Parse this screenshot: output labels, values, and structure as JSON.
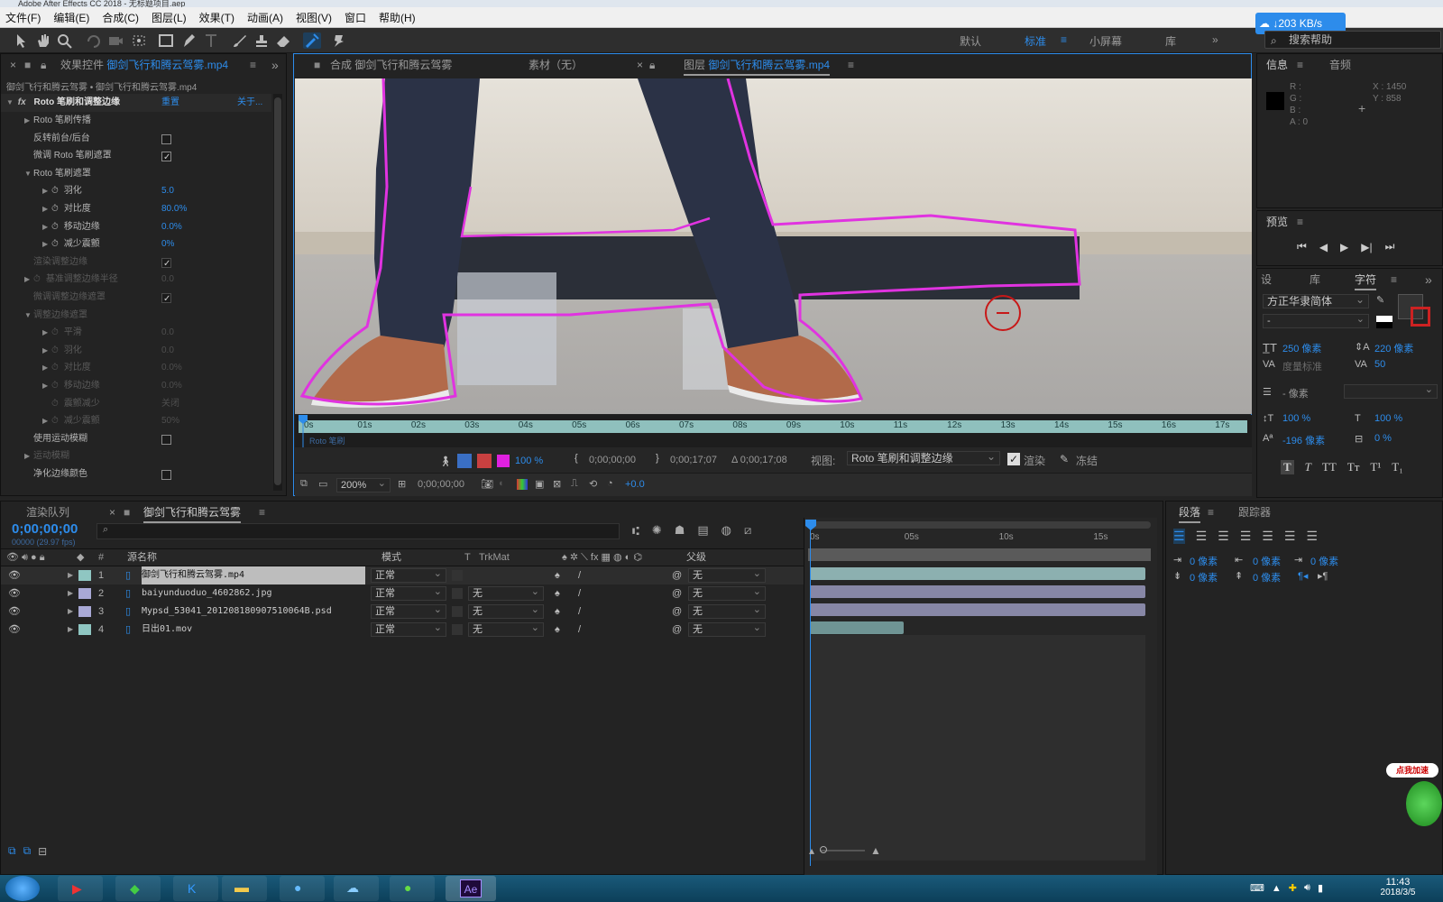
{
  "titlebar": {
    "text": "Adobe After Effects CC 2018 - 无标题项目.aep"
  },
  "menu": [
    "文件(F)",
    "编辑(E)",
    "合成(C)",
    "图层(L)",
    "效果(T)",
    "动画(A)",
    "视图(V)",
    "窗口",
    "帮助(H)"
  ],
  "workspaces": {
    "items": [
      "默认",
      "标准",
      "小屏幕",
      "库"
    ],
    "active": "标准"
  },
  "net_speed": "203 KB/s",
  "search_help": "搜索帮助",
  "effects_panel": {
    "tab_prefix": "效果控件",
    "tab_layer": "御剑飞行和腾云驾雾.mp4",
    "breadcrumb": "御剑飞行和腾云驾雾 • 御剑飞行和腾云驾雾.mp4",
    "effect_name": "Roto 笔刷和调整边缘",
    "reset": "重置",
    "about": "关于...",
    "rows": [
      {
        "label": "Roto 笔刷传播",
        "indent": 1,
        "tri": true
      },
      {
        "label": "反转前台/后台",
        "indent": 1,
        "check": "off"
      },
      {
        "label": "微调 Roto 笔刷遮罩",
        "indent": 1,
        "check": "on"
      },
      {
        "label": "Roto 笔刷遮罩",
        "indent": 1,
        "open": true
      },
      {
        "label": "羽化",
        "indent": 2,
        "tri": true,
        "stop": true,
        "value": "5.0"
      },
      {
        "label": "对比度",
        "indent": 2,
        "tri": true,
        "stop": true,
        "value": "80.0%"
      },
      {
        "label": "移动边缘",
        "indent": 2,
        "tri": true,
        "stop": true,
        "value": "0.0%"
      },
      {
        "label": "减少震颤",
        "indent": 2,
        "tri": true,
        "stop": true,
        "value": "0%"
      },
      {
        "label": "渲染调整边缘",
        "indent": 1,
        "check": "on",
        "dim": true
      },
      {
        "label": "基准调整边缘半径",
        "indent": 1,
        "tri": true,
        "stop": true,
        "value": "0.0",
        "dim": true
      },
      {
        "label": "微调调整边缘遮罩",
        "indent": 1,
        "check": "on",
        "dim": true
      },
      {
        "label": "调整边缘遮罩",
        "indent": 1,
        "open": true,
        "dim": true
      },
      {
        "label": "平滑",
        "indent": 2,
        "tri": true,
        "stop": true,
        "value": "0.0",
        "dim": true
      },
      {
        "label": "羽化",
        "indent": 2,
        "tri": true,
        "stop": true,
        "value": "0.0",
        "dim": true
      },
      {
        "label": "对比度",
        "indent": 2,
        "tri": true,
        "stop": true,
        "value": "0.0%",
        "dim": true
      },
      {
        "label": "移动边缘",
        "indent": 2,
        "tri": true,
        "stop": true,
        "value": "0.0%",
        "dim": true
      },
      {
        "label": "震颤减少",
        "indent": 2,
        "stop": true,
        "value": "关闭",
        "dim": true
      },
      {
        "label": "减少震颤",
        "indent": 2,
        "tri": true,
        "stop": true,
        "value": "50%",
        "dim": true
      },
      {
        "label": "使用运动模糊",
        "indent": 1,
        "check": "off"
      },
      {
        "label": "运动模糊",
        "indent": 1,
        "tri": true,
        "dim": true
      },
      {
        "label": "净化边缘颜色",
        "indent": 1,
        "check": "off"
      }
    ]
  },
  "viewer": {
    "tab_comp": "合成 御剑飞行和腾云驾雾",
    "tab_footage": "素材（无）",
    "tab_layer_prefix": "图层",
    "tab_layer_name": "御剑飞行和腾云驾雾.mp4",
    "ruler_labels": [
      "0s",
      "01s",
      "02s",
      "03s",
      "04s",
      "05s",
      "06s",
      "07s",
      "08s",
      "09s",
      "10s",
      "11s",
      "12s",
      "13s",
      "14s",
      "15s",
      "16s",
      "17s"
    ],
    "ruler_sub": "Roto 笔刷",
    "brush_pct": "100 %",
    "time_in": "0;00;00;00",
    "time_out": "0;00;17;07",
    "duration": "Δ 0;00;17;08",
    "view_label": "视图:",
    "view_value": "Roto 笔刷和调整边缘",
    "render_label": "渲染",
    "freeze_label": "冻结",
    "zoom": "200%",
    "current_time": "0;00;00;00",
    "exposure": "+0.0"
  },
  "info_panel": {
    "tab": "信息",
    "tab2": "音频",
    "r": "R :",
    "g": "G :",
    "b": "B :",
    "a": "A : 0",
    "x": "X : 1450",
    "y": "Y : 858"
  },
  "preview_panel": {
    "tab": "预览"
  },
  "character_panel": {
    "tabs": [
      "设",
      "库",
      "字符"
    ],
    "font": "方正华隶简体",
    "style": "-",
    "size": "250 像素",
    "leading": "220 像素",
    "kerning": "度量标准",
    "tracking": "50",
    "stroke": "- 像素",
    "vscale": "100 %",
    "hscale": "100 %",
    "baseline": "-196 像素",
    "tsume": "0 %",
    "styles": [
      "T",
      "T",
      "TT",
      "Tт",
      "T¹",
      "T₁"
    ]
  },
  "timeline": {
    "tab_render": "渲染队列",
    "tab_comp": "御剑飞行和腾云驾雾",
    "timecode": "0;00;00;00",
    "fps": "00000 (29.97 fps)",
    "headers": {
      "num": "#",
      "name": "源名称",
      "mode": "模式",
      "t": "T",
      "trkmat": "TrkMat",
      "parent": "父级"
    },
    "ruler": [
      "0s",
      "05s",
      "10s",
      "15s"
    ],
    "layers": [
      {
        "num": "1",
        "name": "御剑飞行和腾云驾雾.mp4",
        "mode": "正常",
        "trk": "",
        "parent": "无",
        "color": "#8fc6c2"
      },
      {
        "num": "2",
        "name": "baiyunduoduo_4602862.jpg",
        "mode": "正常",
        "trk": "无",
        "parent": "无",
        "color": "#a9a9d6"
      },
      {
        "num": "3",
        "name": "Mypsd_53041_201208180907510064B.psd",
        "mode": "正常",
        "trk": "无",
        "parent": "无",
        "color": "#a9a9d6"
      },
      {
        "num": "4",
        "name": "日出01.mov",
        "mode": "正常",
        "trk": "无",
        "parent": "无",
        "color": "#8fc6c2"
      }
    ],
    "bars": [
      {
        "start": 0.0,
        "end": 1.0,
        "color": "#8cb0b0"
      },
      {
        "start": 0.0,
        "end": 1.0,
        "color": "#8787a6"
      },
      {
        "start": 0.0,
        "end": 1.0,
        "color": "#8787a6"
      },
      {
        "start": 0.0,
        "end": 0.28,
        "color": "#6f9494"
      }
    ]
  },
  "paragraph_panel": {
    "tab": "段落",
    "tab2": "跟踪器",
    "indent_left": "0 像素",
    "indent_first": "0 像素",
    "indent_right": "0 像素",
    "space_before": "0 像素",
    "space_after": "0 像素"
  },
  "taskbar": {
    "time": "11:43",
    "date": "2018/3/5"
  },
  "float_badge": "点我加速",
  "colors": {
    "accent": "#2d8ceb",
    "roto_outline": "#e033e0",
    "panel": "#232323"
  }
}
